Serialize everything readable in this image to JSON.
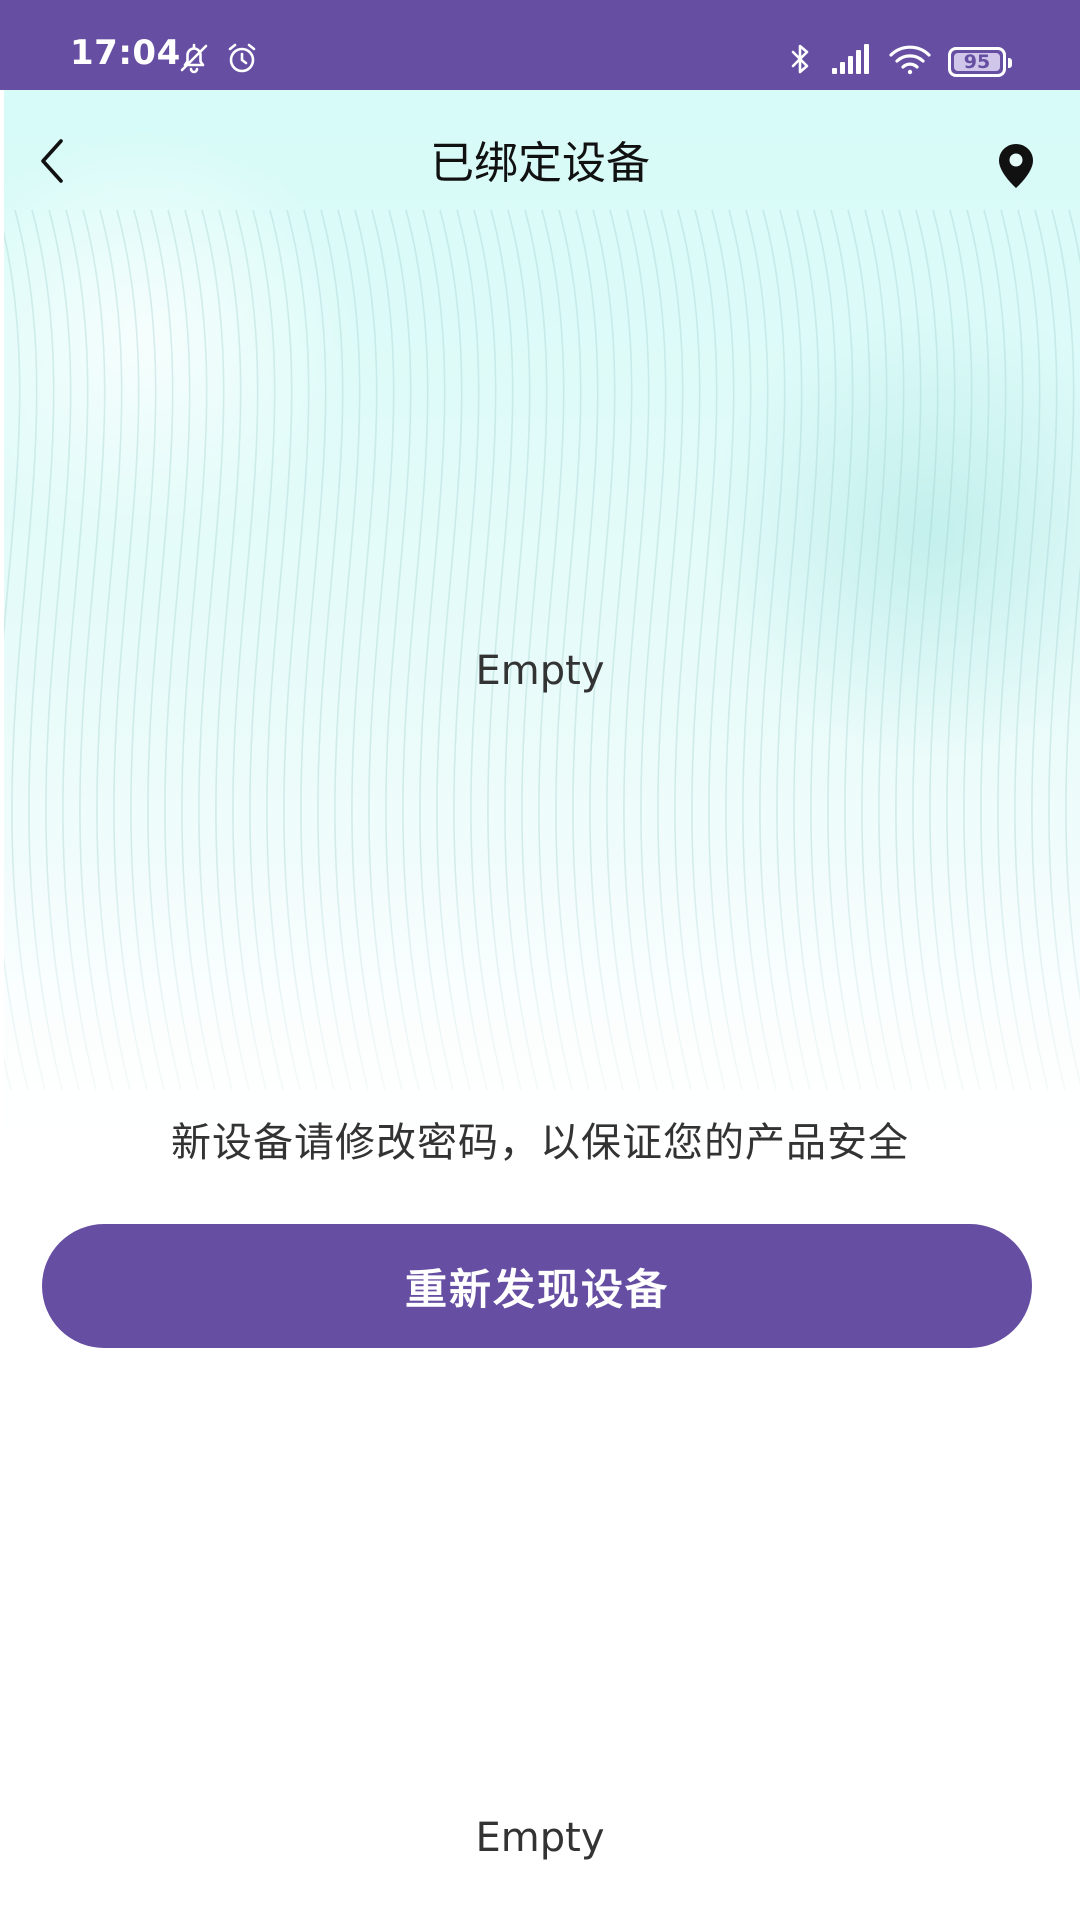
{
  "status_bar": {
    "time": "17:04",
    "battery_level": "95",
    "background_color": "#664fa2",
    "icons": [
      "notifications-off-icon",
      "alarm-icon",
      "bluetooth-icon",
      "cellular-signal-icon",
      "wifi-icon",
      "battery-icon"
    ]
  },
  "nav": {
    "title": "已绑定设备",
    "back_icon": "chevron-left-icon",
    "location_icon": "location-pin-icon"
  },
  "content": {
    "empty_top": "Empty",
    "hint": "新设备请修改密码，以保证您的产品安全",
    "rediscover_button": "重新发现设备",
    "empty_bottom": "Empty"
  },
  "colors": {
    "accent": "#664fa2",
    "hero_gradient_top": "#d6fbf8",
    "text_primary": "#111111",
    "text_secondary": "#333333"
  }
}
